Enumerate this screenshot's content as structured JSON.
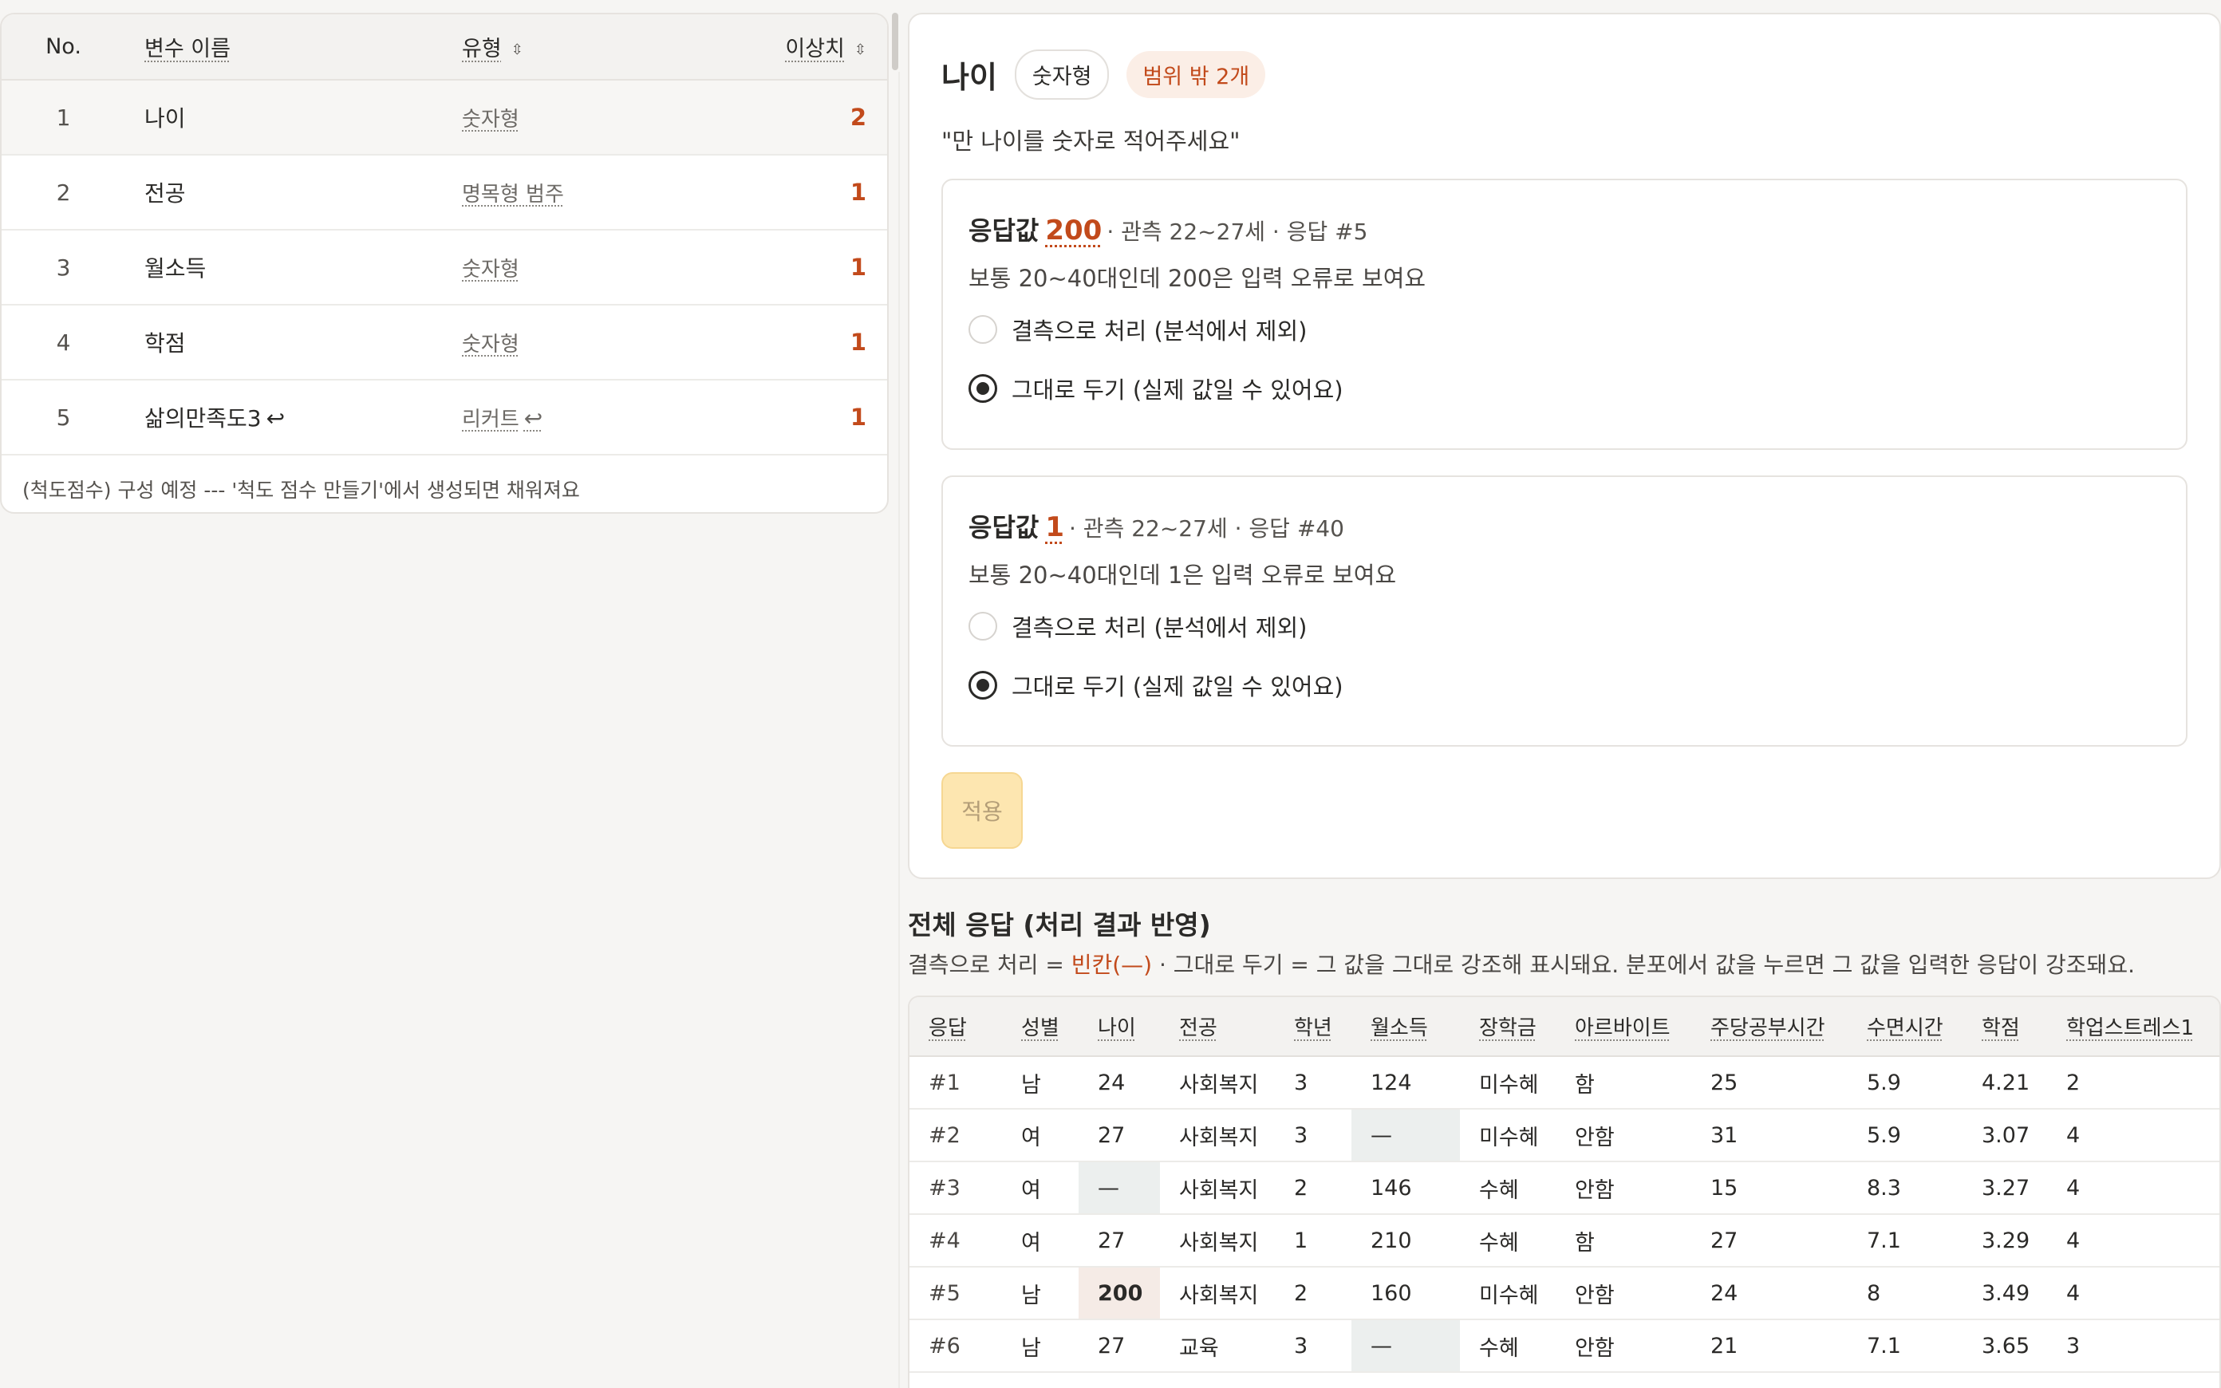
{
  "variables_table": {
    "headers": {
      "no": "No.",
      "name": "변수 이름",
      "type": "유형",
      "outliers": "이상치"
    },
    "rows": [
      {
        "no": "1",
        "name": "나이",
        "type": "숫자형",
        "outliers": "2"
      },
      {
        "no": "2",
        "name": "전공",
        "type": "명목형 범주",
        "outliers": "1"
      },
      {
        "no": "3",
        "name": "월소득",
        "type": "숫자형",
        "outliers": "1"
      },
      {
        "no": "4",
        "name": "학점",
        "type": "숫자형",
        "outliers": "1"
      },
      {
        "no": "5",
        "name": "삶의만족도3",
        "type": "리커트",
        "outliers": "1"
      }
    ],
    "return_glyph": "↩",
    "footer": "(척도점수) 구성 예정 --- '척도 점수 만들기'에서 생성되면 채워져요"
  },
  "detail": {
    "title": "나이",
    "type_badge": "숫자형",
    "outlier_badge": "범위 밖 2개",
    "question": "\"만 나이를 숫자로 적어주세요\"",
    "outliers": [
      {
        "label": "응답값",
        "value": "200",
        "meta": "· 관측 22~27세 · 응답 #5",
        "description": "보통 20~40대인데 200은 입력 오류로 보여요",
        "option_missing": "결측으로 처리 (분석에서 제외)",
        "option_keep": "그대로 두기 (실제 값일 수 있어요)"
      },
      {
        "label": "응답값",
        "value": "1",
        "meta": "· 관측 22~27세 · 응답 #40",
        "description": "보통 20~40대인데 1은 입력 오류로 보여요",
        "option_missing": "결측으로 처리 (분석에서 제외)",
        "option_keep": "그대로 두기 (실제 값일 수 있어요)"
      }
    ],
    "apply_label": "적용"
  },
  "responses": {
    "title": "전체 응답 (처리 결과 반영)",
    "desc_pre": "결측으로 처리 = ",
    "desc_blank": "빈칸(—)",
    "desc_post": " · 그대로 두기 = 그 값을 그대로 강조해 표시돼요. 분포에서 값을 누르면 그 값을 입력한 응답이 강조돼요.",
    "headers": [
      "응답",
      "성별",
      "나이",
      "전공",
      "학년",
      "월소득",
      "장학금",
      "아르바이트",
      "주당공부시간",
      "수면시간",
      "학점",
      "학업스트레스1"
    ],
    "rows": [
      [
        "#1",
        "남",
        "24",
        "사회복지",
        "3",
        "124",
        "미수혜",
        "함",
        "25",
        "5.9",
        "4.21",
        "2"
      ],
      [
        "#2",
        "여",
        "27",
        "사회복지",
        "3",
        "—",
        "미수혜",
        "안함",
        "31",
        "5.9",
        "3.07",
        "4"
      ],
      [
        "#3",
        "여",
        "—",
        "사회복지",
        "2",
        "146",
        "수혜",
        "안함",
        "15",
        "8.3",
        "3.27",
        "4"
      ],
      [
        "#4",
        "여",
        "27",
        "사회복지",
        "1",
        "210",
        "수혜",
        "함",
        "27",
        "7.1",
        "3.29",
        "4"
      ],
      [
        "#5",
        "남",
        "200",
        "사회복지",
        "2",
        "160",
        "미수혜",
        "안함",
        "24",
        "8",
        "3.49",
        "4"
      ],
      [
        "#6",
        "남",
        "27",
        "교육",
        "3",
        "—",
        "수혜",
        "안함",
        "21",
        "7.1",
        "3.65",
        "3"
      ]
    ]
  }
}
